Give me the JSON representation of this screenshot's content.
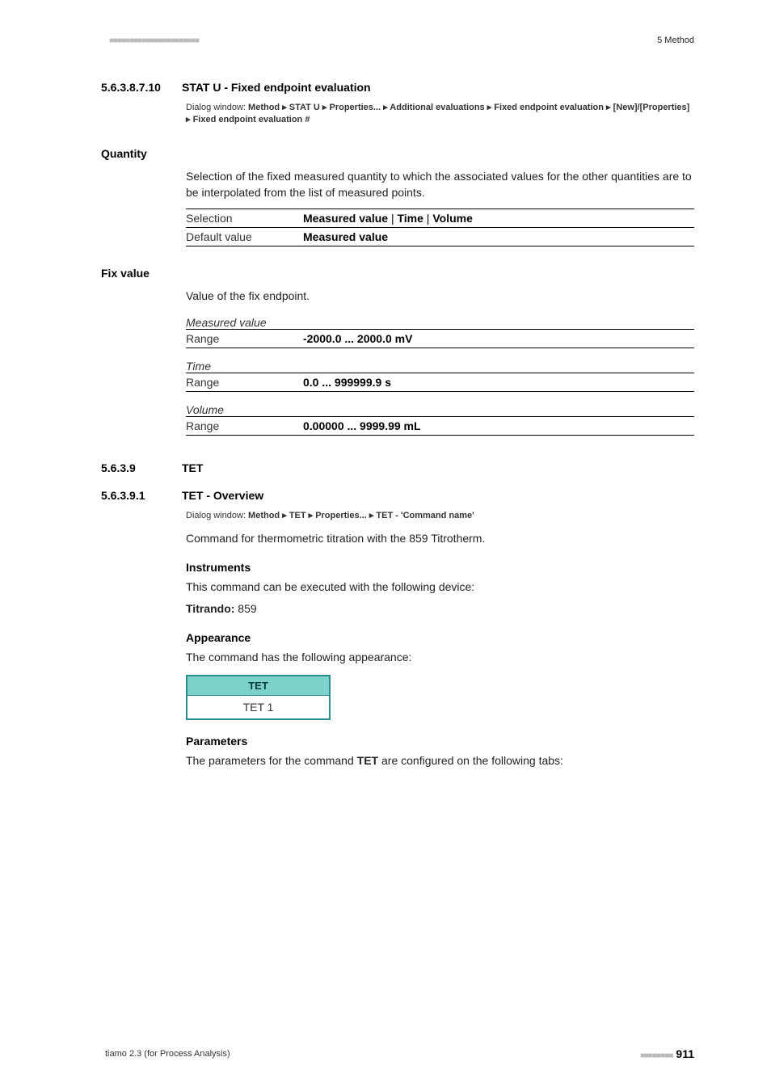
{
  "topbar": {
    "dots": "■■■■■■■■■■■■■■■■■■■■■■",
    "right": "5 Method"
  },
  "s1": {
    "num": "5.6.3.8.7.10",
    "title": "STAT U - Fixed endpoint evaluation",
    "dialog_prefix": "Dialog window: ",
    "dialog_rest": "Method ▸ STAT U ▸ Properties... ▸ Additional evaluations ▸ Fixed endpoint evaluation ▸ [New]/[Properties] ▸ Fixed endpoint evaluation #"
  },
  "quantity": {
    "heading": "Quantity",
    "text": "Selection of the fixed measured quantity to which the associated values for the other quantities are to be interpolated from the list of measured points.",
    "row1_key": "Selection",
    "row1_val_prefix": "Measured value",
    "row1_val_mid1": " | ",
    "row1_val_time": "Time",
    "row1_val_mid2": " | ",
    "row1_val_vol": "Volume",
    "row2_key": "Default value",
    "row2_val": "Measured value"
  },
  "fixvalue": {
    "heading": "Fix value",
    "text": "Value of the fix endpoint.",
    "mv_label": "Measured value",
    "mv_key": "Range",
    "mv_val": "-2000.0 ... 2000.0 mV",
    "time_label": "Time",
    "time_key": "Range",
    "time_val": "0.0 ... 999999.9 s",
    "vol_label": "Volume",
    "vol_key": "Range",
    "vol_val": "0.00000 ... 9999.99 mL"
  },
  "tet": {
    "num": "5.6.3.9",
    "title": "TET"
  },
  "tetov": {
    "num": "5.6.3.9.1",
    "title": "TET - Overview",
    "dialog_prefix": "Dialog window: ",
    "dialog_rest": "Method ▸ TET ▸ Properties... ▸ TET - 'Command name'",
    "cmd_text": "Command for thermometric titration with the 859 Titrotherm.",
    "instr_h": "Instruments",
    "instr_text": "This command can be executed with the following device:",
    "titrando_label": "Titrando: ",
    "titrando_val": "859",
    "app_h": "Appearance",
    "app_text": "The command has the following appearance:",
    "box_hdr": "TET",
    "box_body": "TET 1",
    "param_h": "Parameters",
    "param_text_pre": "The parameters for the command ",
    "param_text_cmd": "TET",
    "param_text_post": " are configured on the following tabs:"
  },
  "footer": {
    "left": "tiamo 2.3 (for Process Analysis)",
    "dots": "■■■■■■■■",
    "page": "911"
  }
}
